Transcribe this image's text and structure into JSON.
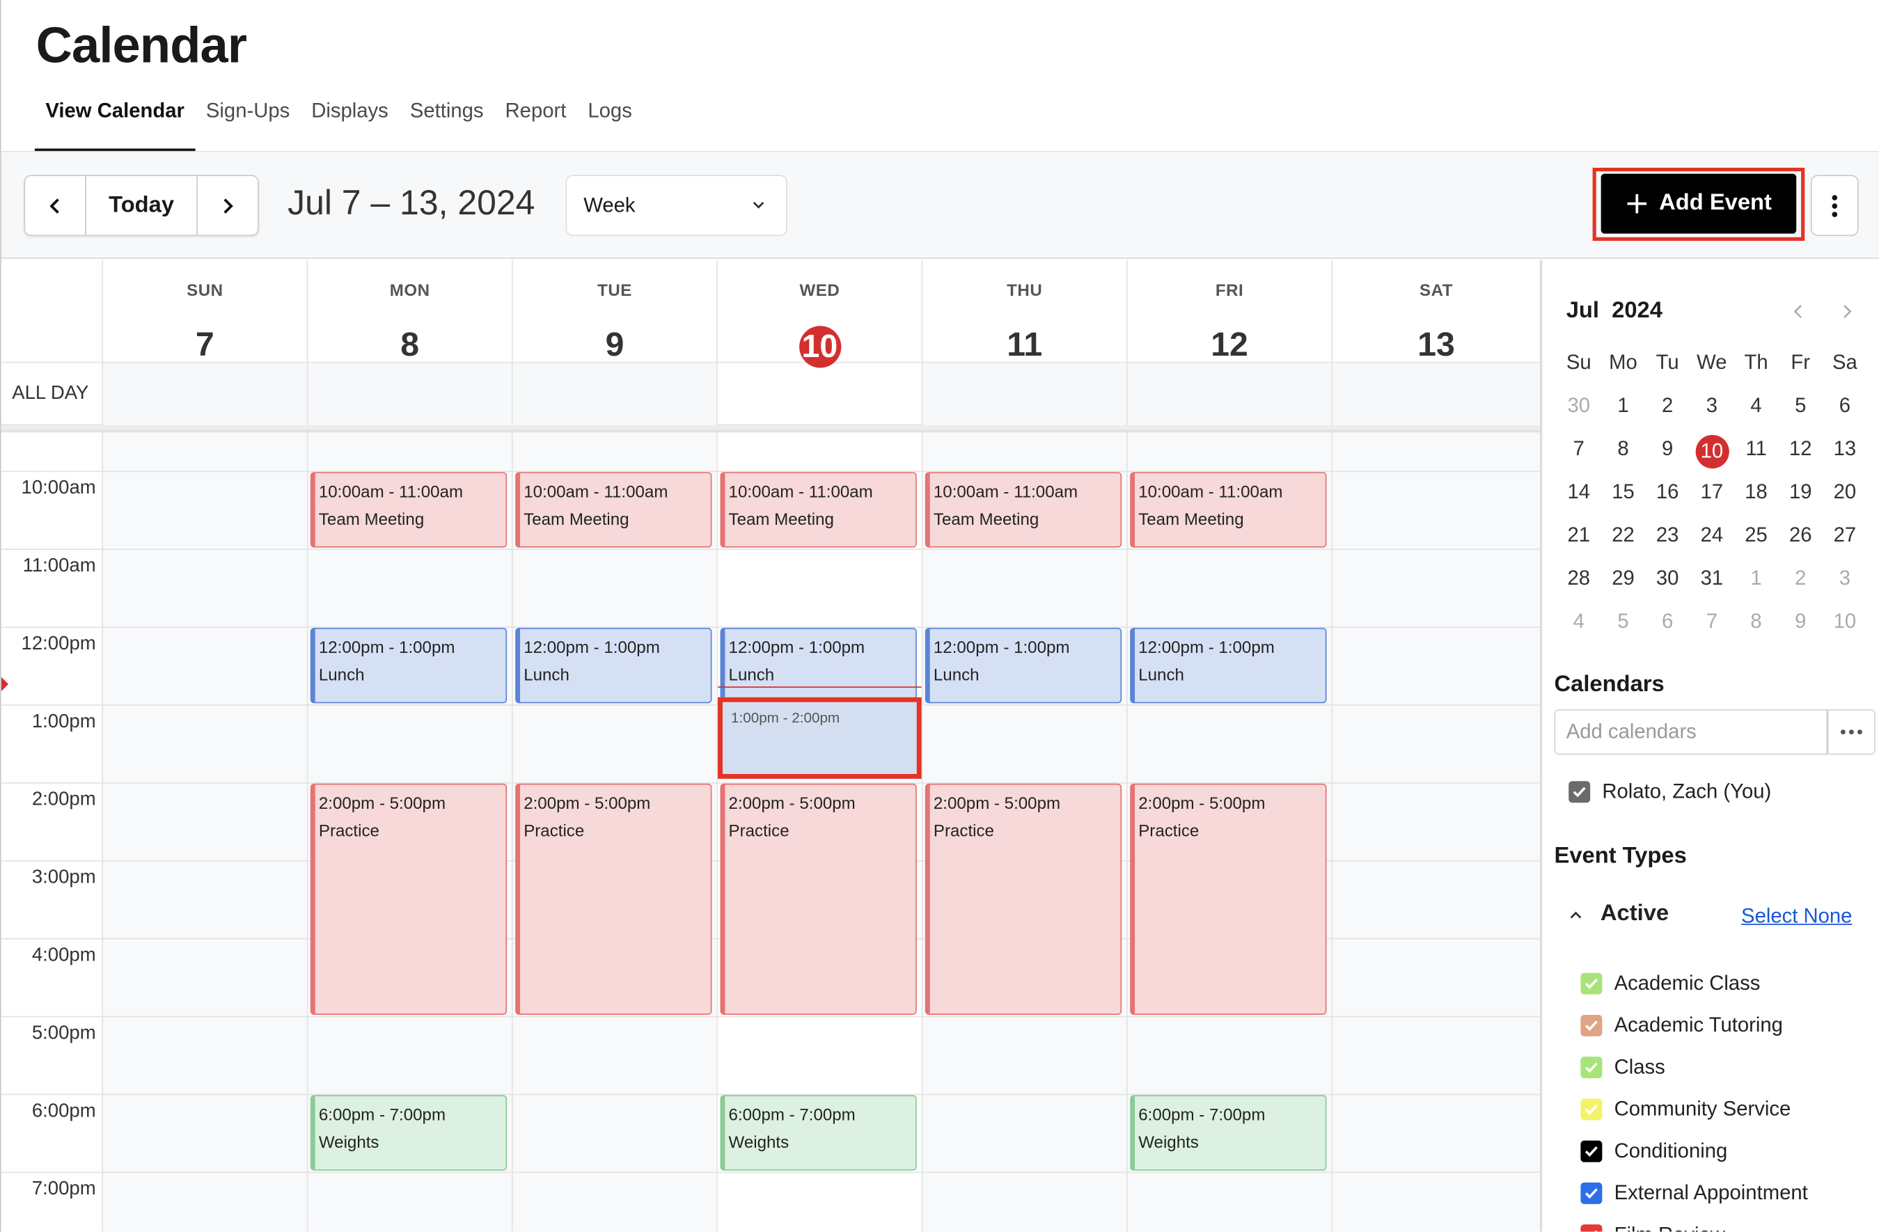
{
  "header": {
    "title": "Calendar",
    "tabs": [
      "View Calendar",
      "Sign-Ups",
      "Displays",
      "Settings",
      "Report",
      "Logs"
    ],
    "active_tab": "View Calendar"
  },
  "toolbar": {
    "today_label": "Today",
    "date_range": "Jul 7 – 13, 2024",
    "view_select": "Week",
    "add_event_label": "Add Event"
  },
  "week": {
    "days": [
      {
        "name": "SUN",
        "date": "7"
      },
      {
        "name": "MON",
        "date": "8"
      },
      {
        "name": "TUE",
        "date": "9"
      },
      {
        "name": "WED",
        "date": "10",
        "today": true
      },
      {
        "name": "THU",
        "date": "11"
      },
      {
        "name": "FRI",
        "date": "12"
      },
      {
        "name": "SAT",
        "date": "13"
      }
    ],
    "all_day_label": "ALL DAY",
    "time_labels": [
      "10:00am",
      "11:00am",
      "12:00pm",
      "1:00pm",
      "2:00pm",
      "3:00pm",
      "4:00pm",
      "5:00pm",
      "6:00pm",
      "7:00pm"
    ],
    "new_event_slot": {
      "day": 3,
      "time": "1:00pm - 2:00pm"
    },
    "events": [
      {
        "day": 1,
        "start": 10,
        "end": 11,
        "time": "10:00am - 11:00am",
        "title": "Team Meeting",
        "color": "red"
      },
      {
        "day": 2,
        "start": 10,
        "end": 11,
        "time": "10:00am - 11:00am",
        "title": "Team Meeting",
        "color": "red"
      },
      {
        "day": 3,
        "start": 10,
        "end": 11,
        "time": "10:00am - 11:00am",
        "title": "Team Meeting",
        "color": "red"
      },
      {
        "day": 4,
        "start": 10,
        "end": 11,
        "time": "10:00am - 11:00am",
        "title": "Team Meeting",
        "color": "red"
      },
      {
        "day": 5,
        "start": 10,
        "end": 11,
        "time": "10:00am - 11:00am",
        "title": "Team Meeting",
        "color": "red"
      },
      {
        "day": 1,
        "start": 12,
        "end": 13,
        "time": "12:00pm - 1:00pm",
        "title": "Lunch",
        "color": "blue"
      },
      {
        "day": 2,
        "start": 12,
        "end": 13,
        "time": "12:00pm - 1:00pm",
        "title": "Lunch",
        "color": "blue"
      },
      {
        "day": 3,
        "start": 12,
        "end": 13,
        "time": "12:00pm - 1:00pm",
        "title": "Lunch",
        "color": "blue"
      },
      {
        "day": 4,
        "start": 12,
        "end": 13,
        "time": "12:00pm - 1:00pm",
        "title": "Lunch",
        "color": "blue"
      },
      {
        "day": 5,
        "start": 12,
        "end": 13,
        "time": "12:00pm - 1:00pm",
        "title": "Lunch",
        "color": "blue"
      },
      {
        "day": 1,
        "start": 14,
        "end": 17,
        "time": "2:00pm - 5:00pm",
        "title": "Practice",
        "color": "red"
      },
      {
        "day": 2,
        "start": 14,
        "end": 17,
        "time": "2:00pm - 5:00pm",
        "title": "Practice",
        "color": "red"
      },
      {
        "day": 3,
        "start": 14,
        "end": 17,
        "time": "2:00pm - 5:00pm",
        "title": "Practice",
        "color": "red"
      },
      {
        "day": 4,
        "start": 14,
        "end": 17,
        "time": "2:00pm - 5:00pm",
        "title": "Practice",
        "color": "red"
      },
      {
        "day": 5,
        "start": 14,
        "end": 17,
        "time": "2:00pm - 5:00pm",
        "title": "Practice",
        "color": "red"
      },
      {
        "day": 1,
        "start": 18,
        "end": 19,
        "time": "6:00pm - 7:00pm",
        "title": "Weights",
        "color": "green"
      },
      {
        "day": 3,
        "start": 18,
        "end": 19,
        "time": "6:00pm - 7:00pm",
        "title": "Weights",
        "color": "green"
      },
      {
        "day": 5,
        "start": 18,
        "end": 19,
        "time": "6:00pm - 7:00pm",
        "title": "Weights",
        "color": "green"
      }
    ]
  },
  "mini_calendar": {
    "month": "Jul",
    "year": "2024",
    "weekday_headers": [
      "Su",
      "Mo",
      "Tu",
      "We",
      "Th",
      "Fr",
      "Sa"
    ],
    "weeks": [
      [
        "30",
        "1",
        "2",
        "3",
        "4",
        "5",
        "6"
      ],
      [
        "7",
        "8",
        "9",
        "10",
        "11",
        "12",
        "13"
      ],
      [
        "14",
        "15",
        "16",
        "17",
        "18",
        "19",
        "20"
      ],
      [
        "21",
        "22",
        "23",
        "24",
        "25",
        "26",
        "27"
      ],
      [
        "28",
        "29",
        "30",
        "31",
        "1",
        "2",
        "3"
      ],
      [
        "4",
        "5",
        "6",
        "7",
        "8",
        "9",
        "10"
      ]
    ],
    "selected": "10"
  },
  "sidebar": {
    "calendars_heading": "Calendars",
    "add_calendars_placeholder": "Add calendars",
    "calendars": [
      {
        "label": "Rolato, Zach (You)",
        "checked": true,
        "color": "#6b6b6b"
      }
    ],
    "event_types_heading": "Event Types",
    "active_label": "Active",
    "select_none_label": "Select None",
    "event_types": [
      {
        "label": "Academic Class",
        "color": "#a6e47a"
      },
      {
        "label": "Academic Tutoring",
        "color": "#e0a484"
      },
      {
        "label": "Class",
        "color": "#a6e47a"
      },
      {
        "label": "Community Service",
        "color": "#f3f36a"
      },
      {
        "label": "Conditioning",
        "color": "#000000"
      },
      {
        "label": "External Appointment",
        "color": "#2f6ee8"
      },
      {
        "label": "Film Review",
        "color": "#e53935"
      }
    ]
  },
  "colors": {
    "accent": "#000000",
    "today": "#d32f2f",
    "highlight": "#e53324",
    "link": "#1a56d6"
  }
}
